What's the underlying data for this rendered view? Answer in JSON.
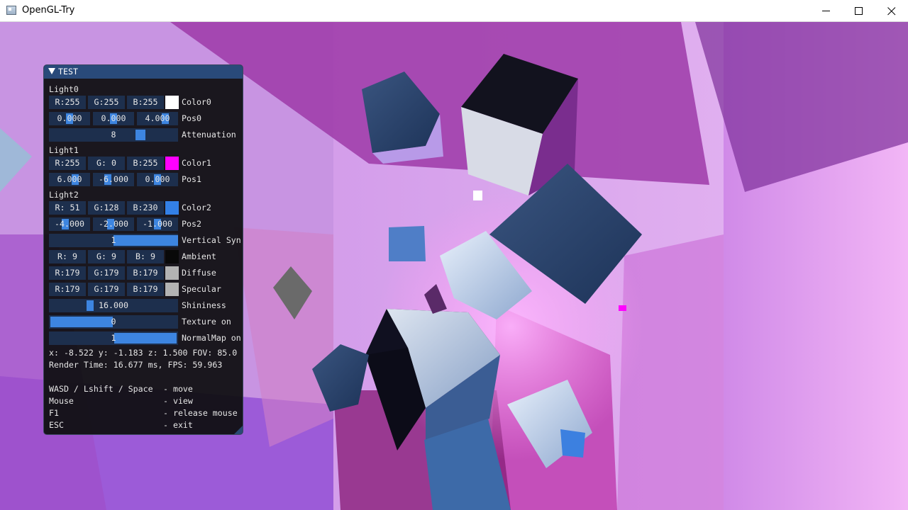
{
  "window": {
    "title": "OpenGL-Try"
  },
  "panel": {
    "title": "TEST",
    "light0": {
      "heading": "Light0",
      "color": {
        "r": "R:255",
        "g": "G:255",
        "b": "B:255",
        "label": "Color0",
        "swatch": "#ffffff"
      },
      "pos": {
        "x": "0.000",
        "y": "0.000",
        "z": "4.000",
        "label": "Pos0"
      },
      "attenuation": {
        "value": "8",
        "label": "Attenuation"
      }
    },
    "light1": {
      "heading": "Light1",
      "color": {
        "r": "R:255",
        "g": "G:  0",
        "b": "B:255",
        "label": "Color1",
        "swatch": "#ff00ff"
      },
      "pos": {
        "x": "6.000",
        "y": "-6.000",
        "z": "0.000",
        "label": "Pos1"
      }
    },
    "light2": {
      "heading": "Light2",
      "color": {
        "r": "R: 51",
        "g": "G:128",
        "b": "B:230",
        "label": "Color2",
        "swatch": "#3380e6"
      },
      "pos": {
        "x": "-4.000",
        "y": "-2.000",
        "z": "-1.000",
        "label": "Pos2"
      }
    },
    "vsync": {
      "value": "1",
      "label": "Vertical Syn"
    },
    "ambient": {
      "r": "R:  9",
      "g": "G:  9",
      "b": "B:  9",
      "label": "Ambient",
      "swatch": "#090909"
    },
    "diffuse": {
      "r": "R:179",
      "g": "G:179",
      "b": "B:179",
      "label": "Diffuse",
      "swatch": "#b3b3b3"
    },
    "specular": {
      "r": "R:179",
      "g": "G:179",
      "b": "B:179",
      "label": "Specular",
      "swatch": "#b3b3b3"
    },
    "shininess": {
      "value": "16.000",
      "label": "Shininess"
    },
    "texture": {
      "value": "0",
      "label": "Texture on"
    },
    "normalmap": {
      "value": "1",
      "label": "NormalMap on"
    },
    "camera": "x: -8.522 y: -1.183 z: 1.500  FOV: 85.0",
    "render": "Render Time: 16.677 ms, FPS: 59.963",
    "controls": [
      {
        "keys": "WASD / Lshift / Space",
        "action": "- move"
      },
      {
        "keys": "Mouse",
        "action": "- view"
      },
      {
        "keys": "F1",
        "action": "- release mouse"
      },
      {
        "keys": "ESC",
        "action": "- exit"
      }
    ]
  }
}
